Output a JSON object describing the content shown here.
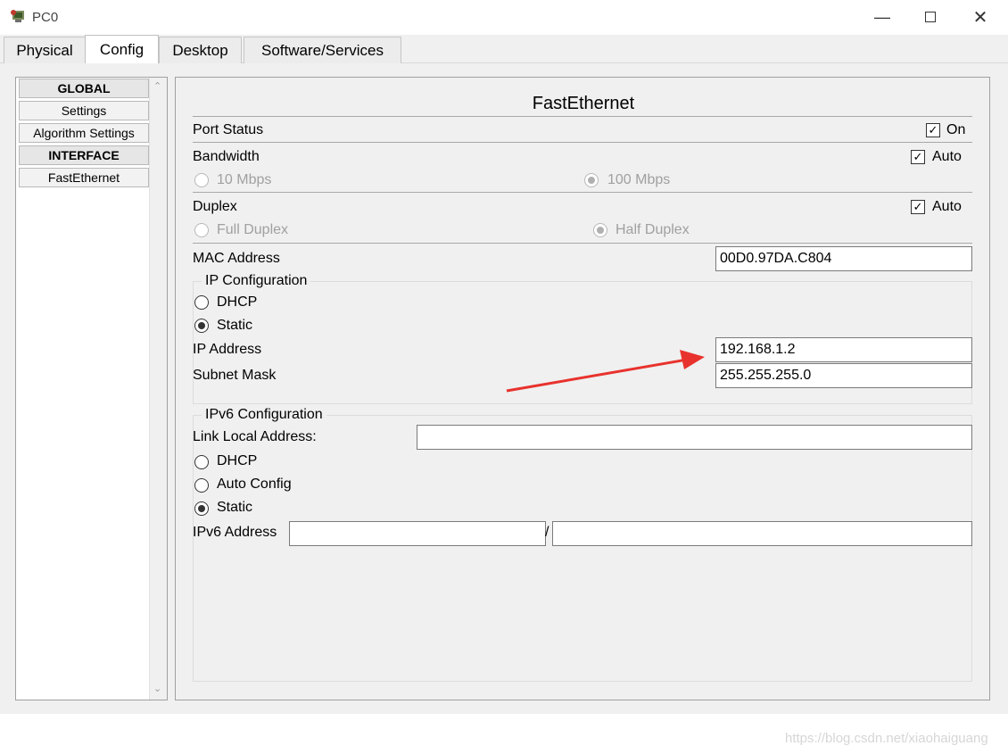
{
  "window": {
    "title": "PC0",
    "icons": [
      "app-icon",
      "minimize-icon",
      "maximize-icon",
      "close-icon"
    ]
  },
  "tabs": [
    {
      "label": "Physical"
    },
    {
      "label": "Config"
    },
    {
      "label": "Desktop"
    },
    {
      "label": "Software/Services"
    }
  ],
  "active_tab": "Config",
  "sidebar": {
    "items": [
      {
        "label": "GLOBAL",
        "type": "header"
      },
      {
        "label": "Settings",
        "type": "item"
      },
      {
        "label": "Algorithm Settings",
        "type": "item"
      },
      {
        "label": "INTERFACE",
        "type": "header"
      },
      {
        "label": "FastEthernet",
        "type": "item"
      }
    ]
  },
  "panel": {
    "title": "FastEthernet",
    "port_status": {
      "label": "Port Status",
      "checkbox_label": "On",
      "checked": true
    },
    "bandwidth": {
      "label": "Bandwidth",
      "auto_label": "Auto",
      "auto_checked": true,
      "option1": "10 Mbps",
      "option2": "100 Mbps",
      "selected": "100 Mbps"
    },
    "duplex": {
      "label": "Duplex",
      "auto_label": "Auto",
      "auto_checked": true,
      "option1": "Full Duplex",
      "option2": "Half Duplex",
      "selected": "Half Duplex"
    },
    "mac": {
      "label": "MAC Address",
      "value": "00D0.97DA.C804"
    },
    "ip_config": {
      "legend": "IP Configuration",
      "dhcp_label": "DHCP",
      "static_label": "Static",
      "selected": "Static",
      "ip_label": "IP Address",
      "ip_value": "192.168.1.2",
      "mask_label": "Subnet Mask",
      "mask_value": "255.255.255.0"
    },
    "ipv6_config": {
      "legend": "IPv6 Configuration",
      "link_local_label": "Link Local Address:",
      "link_local_value": "",
      "dhcp_label": "DHCP",
      "auto_label": "Auto Config",
      "static_label": "Static",
      "selected": "Static",
      "address_label": "IPv6 Address",
      "address_value": "",
      "separator": "/",
      "prefix_value": ""
    }
  },
  "annotation": {
    "arrow_color": "#e8322d"
  },
  "watermark": "https://blog.csdn.net/xiaohaiguang"
}
